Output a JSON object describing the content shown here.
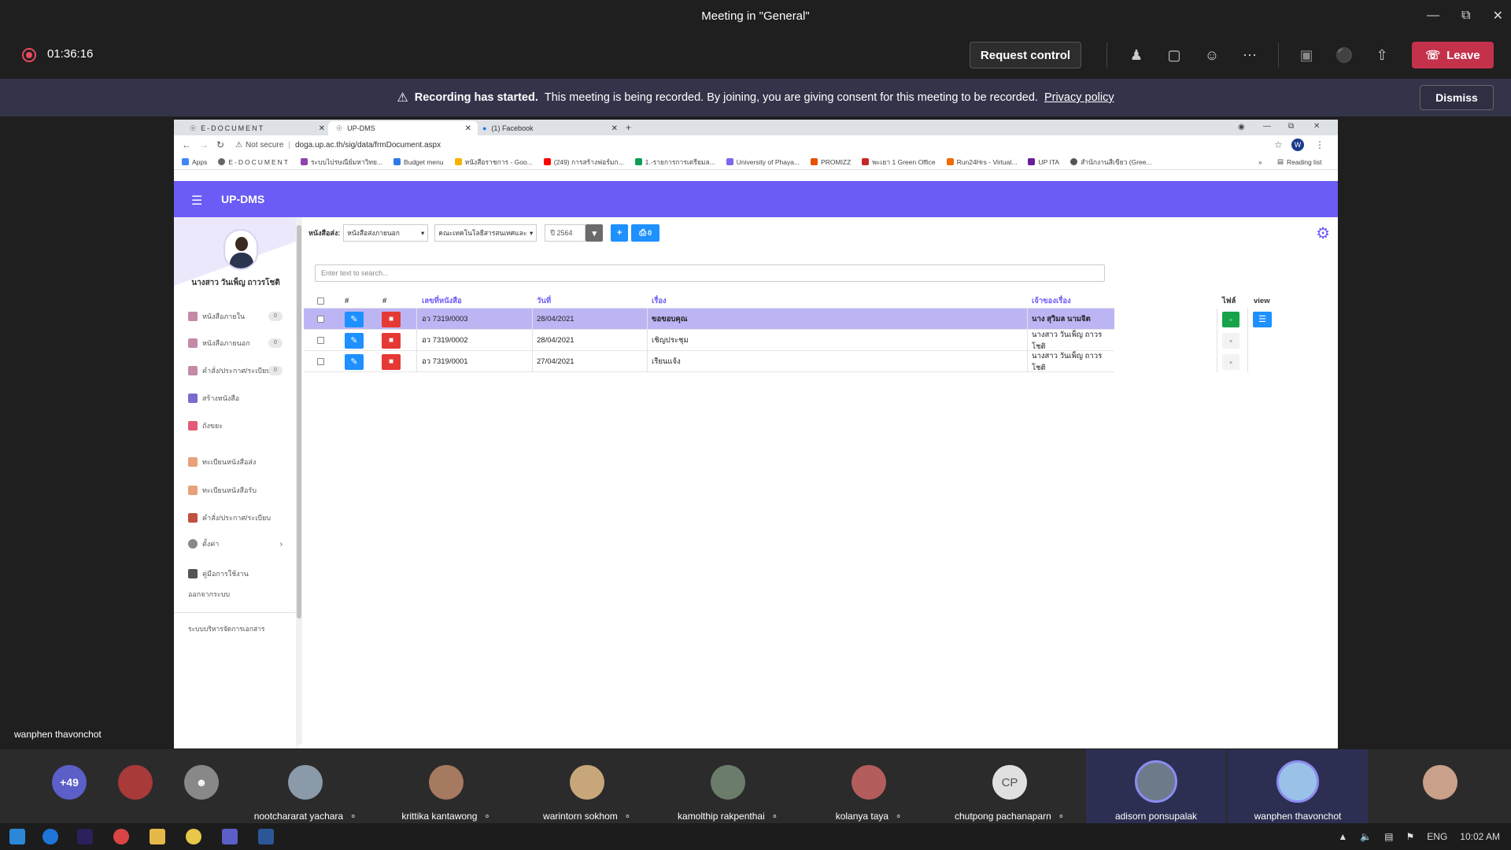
{
  "teams": {
    "title": "Meeting in \"General\"",
    "timer": "01:36:16",
    "request_control": "Request control",
    "leave": "Leave",
    "banner_bold": "Recording has started.",
    "banner_text": "This meeting is being recorded. By joining, you are giving consent for this meeting to be recorded.",
    "banner_link": "Privacy policy",
    "dismiss": "Dismiss",
    "presenter_name": "wanphen thavonchot"
  },
  "browser": {
    "tabs": [
      {
        "label": "E-DOCUMENT"
      },
      {
        "label": "UP-DMS"
      },
      {
        "label": "(1) Facebook"
      }
    ],
    "security": "Not secure",
    "url": "doga.up.ac.th/sig/data/frmDocument.aspx",
    "profile_initial": "W",
    "bookmarks": [
      "Apps",
      "E-DOCUMENT",
      "ระบบไปรษณีย์มหาวิทย...",
      "Budget menu",
      "หนังสือราชการ - Goo...",
      "(249) การสร้างฟอร์มก...",
      "1.-รายการการเตรียมล...",
      "University of Phaya...",
      "PROMIZZ",
      "พะเยา 1 Green Office",
      "Run24Hrs - Virtual...",
      "UP ITA",
      "สำนักงานสีเขียว (Gree..."
    ],
    "reading_list": "Reading list"
  },
  "app": {
    "name": "UP-DMS",
    "user_name": "นางสาว วันเพ็ญ ถาวรโชติ",
    "nav": [
      {
        "label": "หนังสือภายใน",
        "badge": "0"
      },
      {
        "label": "หนังสือภายนอก",
        "badge": "0"
      },
      {
        "label": "คำสั่ง/ประกาศ/ระเบียบ",
        "badge": "0"
      },
      {
        "label": "สร้างหนังสือ",
        "badge": ""
      },
      {
        "label": "ถังขยะ",
        "badge": ""
      },
      {
        "label": "ทะเบียนหนังสือส่ง",
        "badge": ""
      },
      {
        "label": "ทะเบียนหนังสือรับ",
        "badge": ""
      },
      {
        "label": "คำสั่ง/ประกาศ/ระเบียบ",
        "badge": ""
      },
      {
        "label": "ตั้งค่า",
        "badge": ""
      },
      {
        "label": "คู่มือการใช้งาน",
        "badge": ""
      },
      {
        "label": "ออกจากระบบ",
        "badge": ""
      }
    ],
    "footer_text": "ระบบบริหารจัดการเอกสาร",
    "toolbar": {
      "label": "หนังสือส่ง:",
      "type_value": "หนังสือส่งภายนอก",
      "dept_value": "คณะเทคโนโลยีสารสนเทศและ",
      "year": "ปี 2564",
      "print_count": "0"
    },
    "search_placeholder": "Enter text to search...",
    "table": {
      "headers": [
        "#",
        "#",
        "เลขที่หนังสือ",
        "วันที่",
        "เรื่อง",
        "เจ้าของเรื่อง",
        "ไฟล์",
        "view"
      ],
      "rows": [
        {
          "no": "อว 7319/0003",
          "date": "28/04/2021",
          "subject": "ขอขอบคุณ",
          "owner": "นาง สุวิมล นามจิต"
        },
        {
          "no": "อว 7319/0002",
          "date": "28/04/2021",
          "subject": "เชิญประชุม",
          "owner": "นางสาว วันเพ็ญ ถาวรโชติ"
        },
        {
          "no": "อว 7319/0001",
          "date": "27/04/2021",
          "subject": "เรียนแจ้ง",
          "owner": "นางสาว วันเพ็ญ ถาวรโชติ"
        }
      ]
    }
  },
  "participants": {
    "overflow": "+49",
    "tiles": [
      {
        "name": "nootchararat yachara"
      },
      {
        "name": "krittika kantawong"
      },
      {
        "name": "warintorn sokhom"
      },
      {
        "name": "kamolthip rakpenthai"
      },
      {
        "name": "kolanya taya"
      },
      {
        "name": "chutpong pachanaparn",
        "initials": "CP"
      },
      {
        "name": "adisorn ponsupalak"
      },
      {
        "name": "wanphen thavonchot"
      }
    ]
  },
  "taskbar": {
    "lang": "ENG",
    "time": "10:02 AM"
  }
}
